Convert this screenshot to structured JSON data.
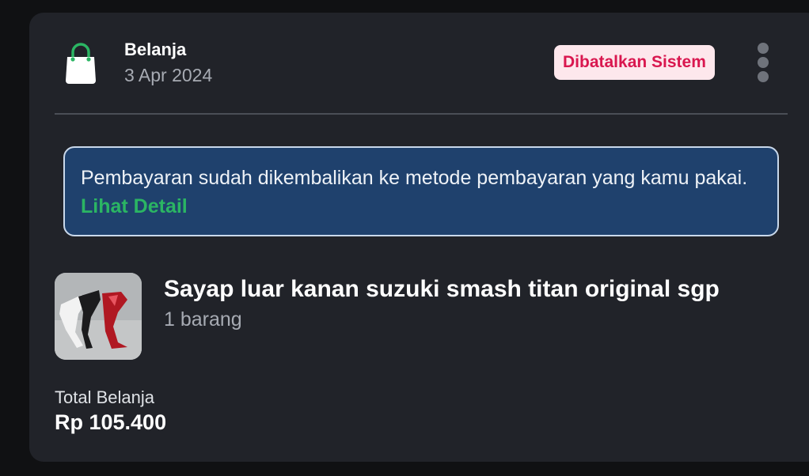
{
  "order": {
    "category": "Belanja",
    "date": "3 Apr 2024",
    "status": "Dibatalkan Sistem",
    "status_color": "#d9174f",
    "status_bg": "#fde7ec"
  },
  "icons": {
    "category": "shopping-bag-icon",
    "menu": "more-vertical-icon"
  },
  "notice": {
    "text": "Pembayaran sudah dikembalikan ke metode pembayaran yang kamu pakai.",
    "link_label": "Lihat Detail",
    "bg_color": "#1f416d",
    "link_color": "#2bb563"
  },
  "product": {
    "name": "Sayap luar kanan suzuki smash titan original sgp",
    "quantity": "1 barang"
  },
  "total": {
    "label": "Total Belanja",
    "value": "Rp 105.400"
  }
}
